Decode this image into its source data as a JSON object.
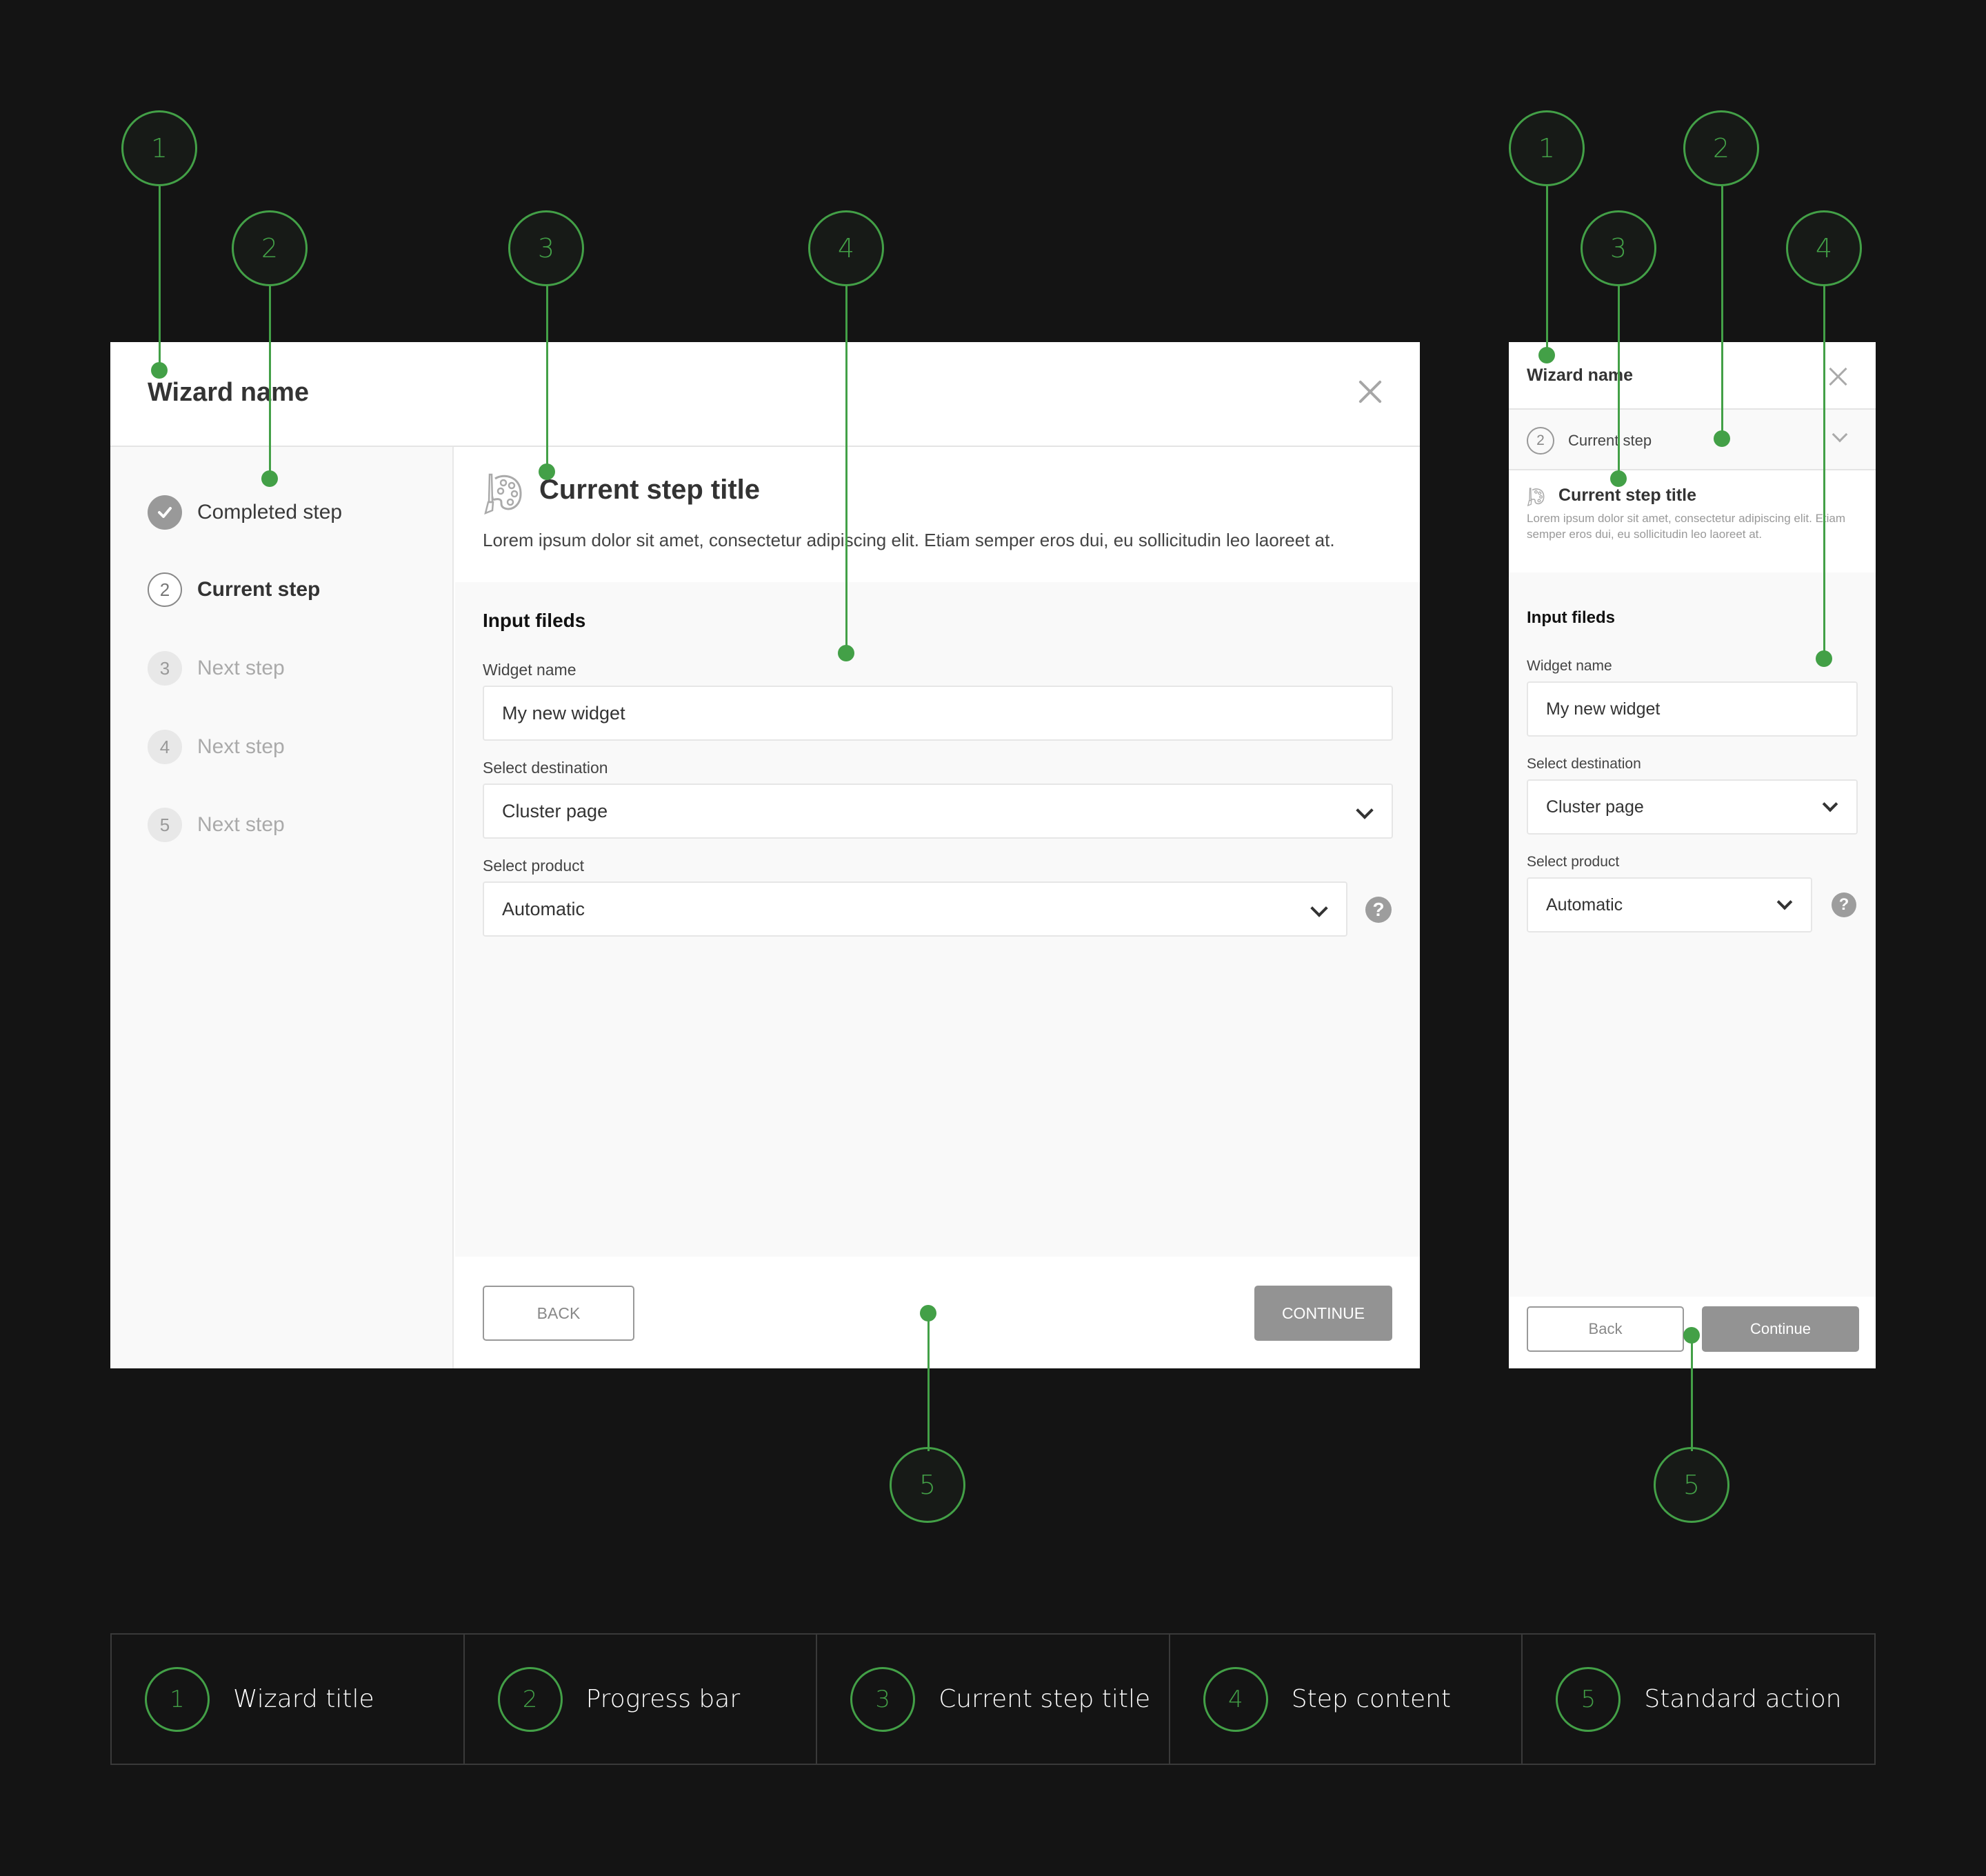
{
  "accent_color": "#43a047",
  "desktop": {
    "wizard_title": "Wizard name",
    "close_icon": "close-icon",
    "steps": [
      {
        "number": "1",
        "label": "Completed step",
        "state": "completed",
        "icon": "check-icon"
      },
      {
        "number": "2",
        "label": "Current step",
        "state": "current"
      },
      {
        "number": "3",
        "label": "Next step",
        "state": "next"
      },
      {
        "number": "4",
        "label": "Next step",
        "state": "next"
      },
      {
        "number": "5",
        "label": "Next step",
        "state": "next"
      }
    ],
    "step_icon": "palette-icon",
    "step_title": "Current step title",
    "step_description": "Lorem ipsum dolor sit amet, consectetur adipiscing elit. Etiam semper eros dui, eu sollicitudin leo laoreet at.",
    "section_title": "Input fileds",
    "fields": {
      "widget_name": {
        "label": "Widget name",
        "value": "My new widget"
      },
      "destination": {
        "label": "Select destination",
        "value": "Cluster page"
      },
      "product": {
        "label": "Select product",
        "value": "Automatic",
        "help_icon": "?"
      }
    },
    "back_label": "BACK",
    "continue_label": "CONTINUE"
  },
  "mobile": {
    "wizard_title": "Wizard name",
    "progress": {
      "number": "2",
      "label": "Current step"
    },
    "step_title": "Current step title",
    "step_description": "Lorem ipsum dolor sit amet, consectetur adipiscing elit. Etiam semper eros dui, eu sollicitudin leo laoreet at.",
    "section_title": "Input fileds",
    "fields": {
      "widget_name": {
        "label": "Widget name",
        "value": "My new widget"
      },
      "destination": {
        "label": "Select destination",
        "value": "Cluster page"
      },
      "product": {
        "label": "Select product",
        "value": "Automatic",
        "help_icon": "?"
      }
    },
    "back_label": "Back",
    "continue_label": "Continue"
  },
  "callouts": [
    "1",
    "2",
    "3",
    "4",
    "5"
  ],
  "legend": [
    {
      "number": "1",
      "label": "Wizard title"
    },
    {
      "number": "2",
      "label": "Progress bar"
    },
    {
      "number": "3",
      "label": "Current step title"
    },
    {
      "number": "4",
      "label": "Step content"
    },
    {
      "number": "5",
      "label": "Standard action"
    }
  ]
}
